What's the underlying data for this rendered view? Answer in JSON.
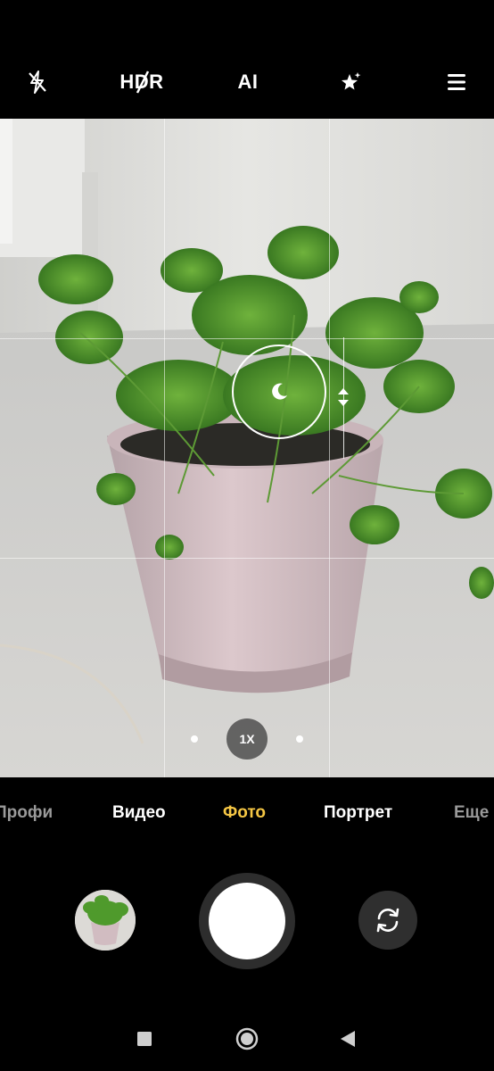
{
  "topbar": {
    "flash_icon": "flash-off-icon",
    "hdr_label": "HDR",
    "ai_label": "AI",
    "beauty_icon": "sparkle-icon",
    "menu_icon": "menu-icon"
  },
  "viewfinder": {
    "focus_icon": "moon-icon",
    "exposure_icon": "exposure-arrows-icon",
    "zoom_label": "1X"
  },
  "modes": [
    {
      "label": "Профи"
    },
    {
      "label": "Видео"
    },
    {
      "label": "Фото"
    },
    {
      "label": "Портрет"
    },
    {
      "label": "Еще"
    }
  ],
  "active_mode": "Фото",
  "colors": {
    "accent": "#f6c744",
    "background": "#000000",
    "control_bg": "#2f2f2f"
  },
  "controls": {
    "gallery_icon": "gallery-thumbnail",
    "shutter_icon": "shutter-button",
    "switch_icon": "switch-camera-icon"
  },
  "navbar": {
    "recents_icon": "square-icon",
    "home_icon": "circle-icon",
    "back_icon": "triangle-back-icon"
  }
}
